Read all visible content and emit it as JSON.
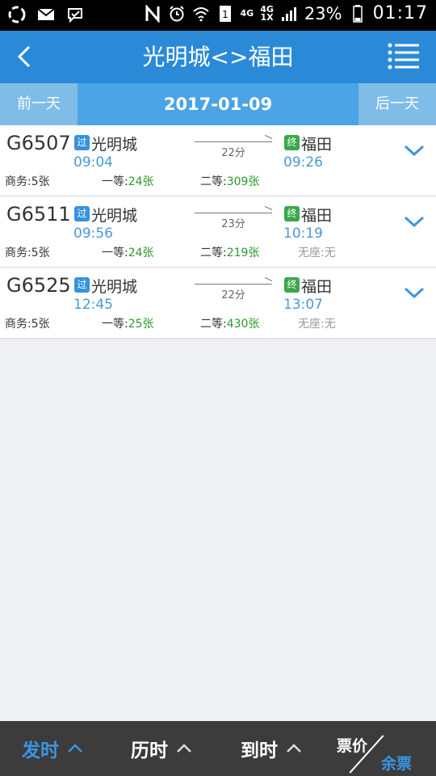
{
  "status_bar": {
    "network_top": "4G",
    "network_mid": "4G",
    "network_sub": "1X",
    "battery": "23%",
    "time": "01:17"
  },
  "header": {
    "title": "光明城<>福田"
  },
  "date_bar": {
    "prev_label": "前一天",
    "date": "2017-01-09",
    "next_label": "后一天"
  },
  "trains": [
    {
      "number": "G6507",
      "pass_badge": "过",
      "from": "光明城",
      "depart": "09:04",
      "duration": "22分",
      "end_badge": "终",
      "to": "福田",
      "arrive": "09:26",
      "business_label": "商务:",
      "business": "5张",
      "first_label": "一等:",
      "first": "24张",
      "second_label": "二等:",
      "second": "309张",
      "noseat": ""
    },
    {
      "number": "G6511",
      "pass_badge": "过",
      "from": "光明城",
      "depart": "09:56",
      "duration": "23分",
      "end_badge": "终",
      "to": "福田",
      "arrive": "10:19",
      "business_label": "商务:",
      "business": "5张",
      "first_label": "一等:",
      "first": "24张",
      "second_label": "二等:",
      "second": "219张",
      "noseat": "无座:无"
    },
    {
      "number": "G6525",
      "pass_badge": "过",
      "from": "光明城",
      "depart": "12:45",
      "duration": "22分",
      "end_badge": "终",
      "to": "福田",
      "arrive": "13:07",
      "business_label": "商务:",
      "business": "5张",
      "first_label": "一等:",
      "first": "25张",
      "second_label": "二等:",
      "second": "430张",
      "noseat": "无座:无"
    }
  ],
  "bottom_bar": {
    "sort_depart": "发时",
    "sort_duration": "历时",
    "sort_arrive": "到时",
    "price_label": "票价",
    "remaining_label": "余票"
  },
  "colors": {
    "nav_blue": "#2a8ad8",
    "date_blue": "#4aa4e6",
    "accent_blue": "#3b95e4",
    "pass_badge": "#3592e0",
    "end_badge": "#3aa84a",
    "ticket_green": "#2a9a2a"
  },
  "icons": [
    "app-icon",
    "mail-icon",
    "message-icon",
    "nfc-icon",
    "alarm-icon",
    "wifi-icon",
    "sim-icon",
    "signal-icon",
    "battery-icon",
    "back-icon",
    "menu-icon",
    "chevron-down-icon",
    "chevron-up-icon"
  ]
}
